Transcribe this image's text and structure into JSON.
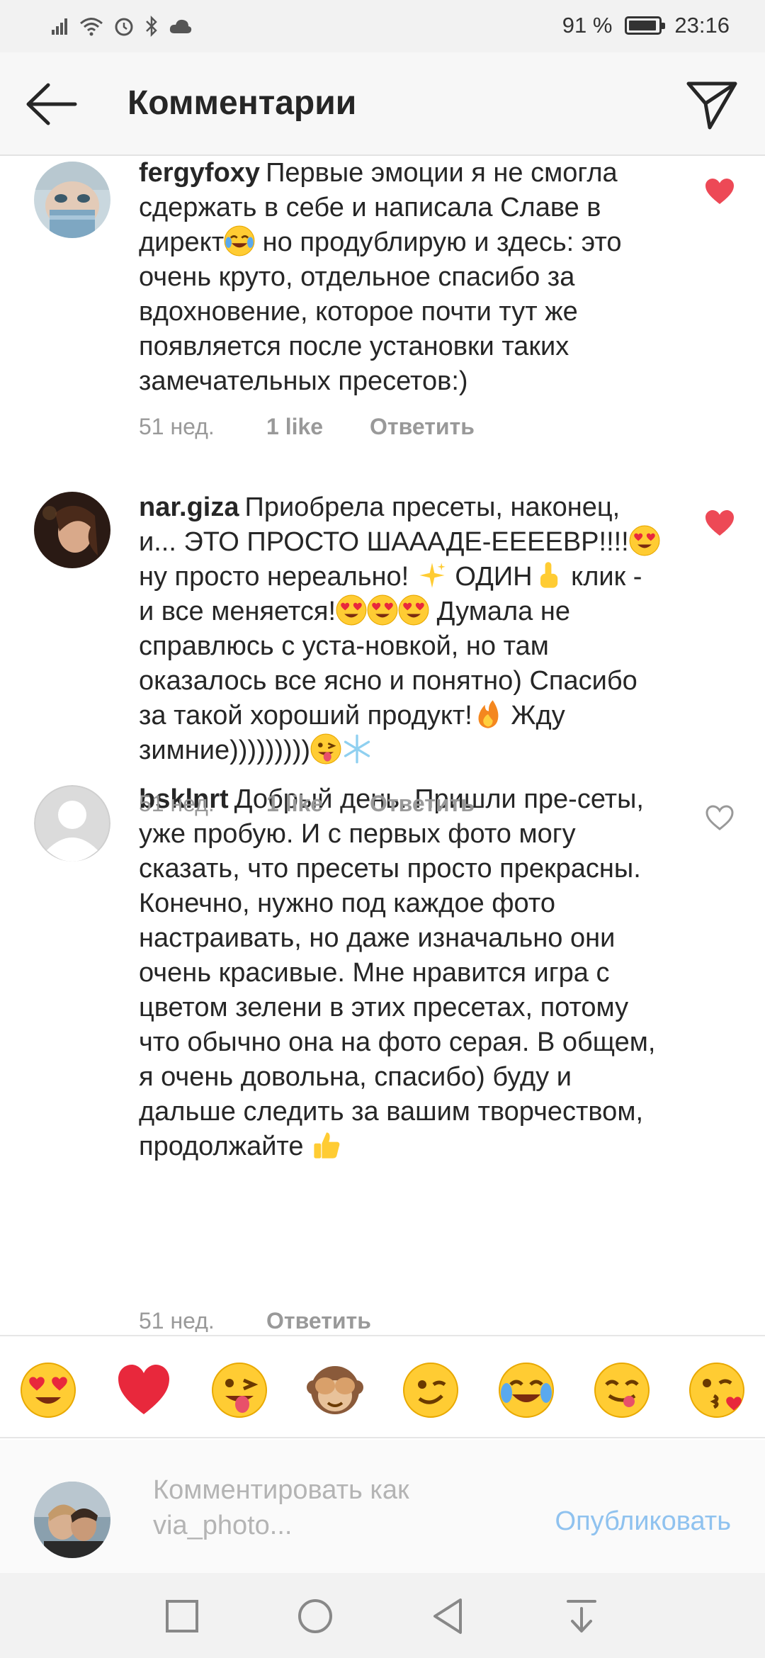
{
  "status_bar": {
    "battery": "91 %",
    "time": "23:16"
  },
  "header": {
    "title": "Комментарии"
  },
  "comments": [
    {
      "username": "fergyfoxy",
      "text_parts": [
        "Первые эмоции я не смогла сдержать в себе и написала Славе в директ",
        " но продублирую и здесь: это очень круто, отдельное спасибо за вдохновение, которое почти тут же появляется после установки таких замечательных пресетов:)"
      ],
      "time": "51 нед.",
      "likes": "1 like",
      "reply": "Ответить",
      "liked": true
    },
    {
      "username": "nar.giza",
      "text_parts": [
        "Приобрела пресеты, наконец, и... ЭТО ПРОСТО ШАААДЕ-ЕЕЕЕВР!!!!",
        " ну просто нереально! ",
        " ОДИН",
        " клик - и все меняется!",
        " Думала не справлюсь с уста-новкой, но там оказалось все ясно и понятно) Спасибо за такой хороший продукт!",
        " Жду зимние)))))))))"
      ],
      "time": "51 нед.",
      "likes": "1 like",
      "reply": "Ответить",
      "liked": true
    },
    {
      "username": "bsklnrt",
      "text_parts": [
        "Добрый день. Пришли пре-сеты, уже пробую. И с первых фото могу сказать, что пресеты просто прекрасны. Конечно, нужно под каждое фото настраивать, но даже изначально они очень красивые. Мне нравится игра с цветом зелени в этих пресетах, потому что обычно она на фото серая. В общем, я очень довольна, спасибо) буду и дальше следить за вашим творчеством, продолжайте "
      ],
      "time": "51 нед.",
      "reply": "Ответить",
      "liked": false
    }
  ],
  "emoji_bar": [
    "heart-eyes",
    "red-heart",
    "tongue-wink",
    "see-no-evil-monkey",
    "wink",
    "tears-of-joy",
    "yum",
    "kissing-heart"
  ],
  "compose": {
    "placeholder": "Комментировать как via_photo...",
    "publish_label": "Опубликовать"
  },
  "colors": {
    "heart": "#ed4956",
    "publish": "#8fc2ef",
    "meta": "#999999"
  }
}
